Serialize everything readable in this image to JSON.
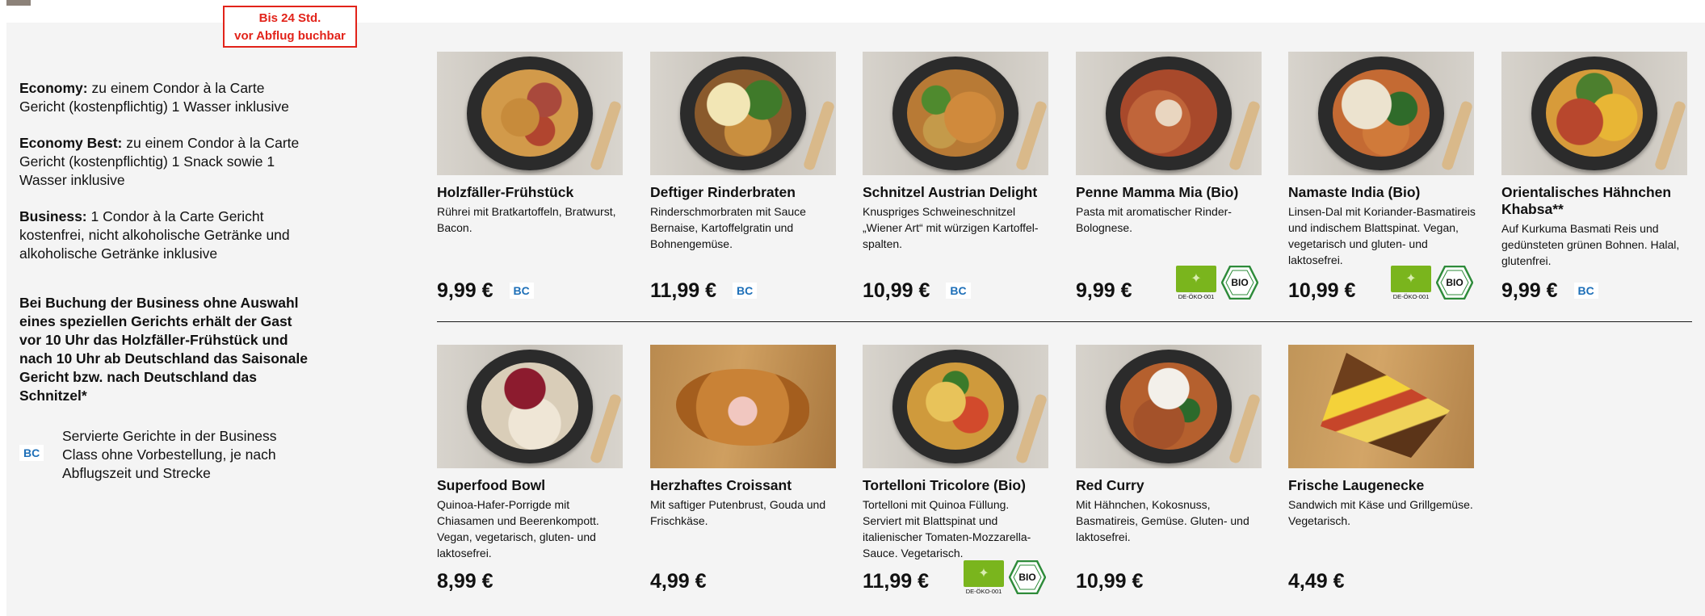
{
  "stamp": {
    "line1": "Bis 24 Std.",
    "line2": "vor Abflug buchbar"
  },
  "info": {
    "economy_label": "Economy:",
    "economy_text": " zu einem Condor à la Carte Gericht (kostenpflichtig) 1 Wasser inklusive",
    "economy_best_label": "Economy Best:",
    "economy_best_text": " zu einem Condor à la Carte Gericht (kostenpflichtig) 1 Snack sowie 1 Wasser inklusive",
    "business_label": "Business:",
    "business_text": " 1 Condor à la Carte Gericht kostenfrei, nicht alkoholische Getränke und alkoholische Getränke inklusive",
    "business_note": "Bei Buchung der Business ohne Auswahl eines speziellen Gerichts erhält der Gast vor 10 Uhr das Holzfäller-Frühstück und nach 10 Uhr ab Deutschland das Saison­ale Gericht bzw. nach Deutschland das Schnitzel*",
    "bc_badge": "BC",
    "bc_legend": "Servierte Gerichte in der Business Class ohne Vorbestellung, je nach Abflugszeit und Strecke"
  },
  "labels": {
    "eu_organic_code": "DE-ÖKO-001",
    "bio_seal": "BIO"
  },
  "colors": {
    "accent_red": "#e2231a",
    "bc_blue": "#1d6fb8",
    "eu_organic_green": "#7ab51d",
    "panel_grey": "#f4f4f4"
  },
  "products": [
    {
      "name": "Holzfäller-Frühstück",
      "desc": "Rührei mit Bratkartoffeln, Bratwurst, Bacon.",
      "price": "9,99 €",
      "bc": "BC",
      "photo": "breakfast-bowl-photo"
    },
    {
      "name": "Deftiger Rinderbraten",
      "desc": "Rinderschmorbraten mit Sauce Bernaise, Kartoffelgratin und Bohnengemüse.",
      "price": "11,99 €",
      "bc": "BC",
      "photo": "roast-beef-bowl-photo"
    },
    {
      "name": "Schnitzel Austrian Delight",
      "desc": "Knuspriges Schweineschnitzel „Wiener Art“ mit würzigen Kartoffel­spalten.",
      "price": "10,99 €",
      "bc": "BC",
      "photo": "schnitzel-bowl-photo"
    },
    {
      "name": "Penne Mamma Mia (Bio)",
      "desc": "Pasta mit aromatischer Rinder-Bolognese.",
      "price": "9,99 €",
      "photo": "penne-bowl-photo"
    },
    {
      "name": "Namaste India (Bio)",
      "desc": "Linsen-Dal mit Koriander-Basmati­reis und indischem Blattspinat. Vegan, vegetarisch und gluten- und laktosefrei.",
      "price": "10,99 €",
      "photo": "dal-bowl-photo"
    },
    {
      "name": "Orientalisches Hähnchen Khabsa**",
      "desc": "Auf Kurkuma Basmati Reis und gedünsteten grünen Bohnen. Halal, glutenfrei.",
      "price": "9,99 €",
      "bc": "BC",
      "photo": "khabsa-bowl-photo"
    },
    {
      "name": "Superfood Bowl",
      "desc": "Quinoa-Hafer-Porrigde mit Chiasamen und Beerenkompott. Vegan, vegetarisch, gluten- und laktosefrei.",
      "price": "8,99 €",
      "photo": "superfood-bowl-photo"
    },
    {
      "name": "Herzhaftes Croissant",
      "desc": "Mit saftiger Putenbrust, Gouda und Frischkäse.",
      "price": "4,99 €",
      "photo": "croissant-photo"
    },
    {
      "name": "Tortelloni Tricolore (Bio)",
      "desc": "Tortelloni mit Quinoa Füllung. Serviert mit Blattspinat und italienischer Tomaten-Mozzarella-Sauce. Vegetarisch.",
      "price": "11,99 €",
      "photo": "tortelloni-bowl-photo"
    },
    {
      "name": "Red Curry",
      "desc": "Mit Hähnchen, Kokosnuss, Basmatireis, Gemüse. Gluten- und laktosefrei.",
      "price": "10,99 €",
      "photo": "red-curry-bowl-photo"
    },
    {
      "name": "Frische Laugenecke",
      "desc": "Sandwich mit Käse und Grillgemüse. Vegetarisch.",
      "price": "4,49 €",
      "photo": "pretzel-sandwich-photo"
    }
  ]
}
